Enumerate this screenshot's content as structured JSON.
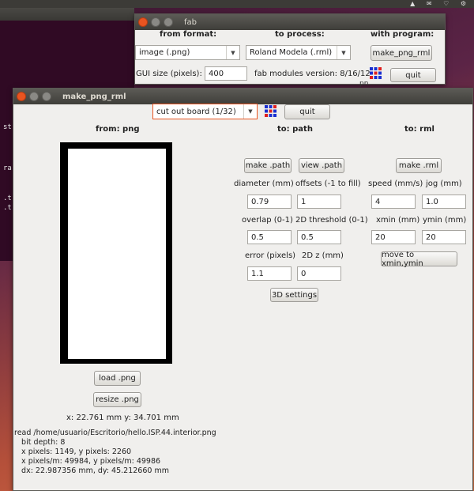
{
  "desktop": {
    "terminal_lines": [
      "st",
      "ra",
      ".tr",
      ".tr"
    ],
    "fab_window_extra": "pn"
  },
  "fab": {
    "title": "fab",
    "from_format_label": "from format:",
    "to_process_label": "to process:",
    "with_program_label": "with program:",
    "from_format_value": "image (.png)",
    "to_process_value": "Roland Modela (.rml)",
    "program_button": "make_png_rml",
    "gui_size_label": "GUI size (pixels):",
    "gui_size_value": "400",
    "version": "fab modules version: 8/16/12",
    "quit": "quit"
  },
  "make": {
    "title": "make_png_rml",
    "process_value": "cut out board (1/32)",
    "quit": "quit",
    "from_label": "from: png",
    "to_path_label": "to: path",
    "to_rml_label": "to: rml",
    "make_path": "make .path",
    "view_path": "view .path",
    "make_rml": "make .rml",
    "diameter_label": "diameter (mm)",
    "diameter_value": "0.79",
    "offsets_label": "offsets (-1 to fill)",
    "offsets_value": "1",
    "overlap_label": "overlap (0-1)",
    "overlap_value": "0.5",
    "threshold_label": "2D threshold (0-1)",
    "threshold_value": "0.5",
    "error_label": "error (pixels)",
    "error_value": "1.1",
    "z2d_label": "2D z (mm)",
    "z2d_value": "0",
    "settings3d": "3D settings",
    "speed_label": "speed (mm/s)",
    "speed_value": "4",
    "jog_label": "jog (mm)",
    "jog_value": "1.0",
    "xmin_label": "xmin (mm)",
    "xmin_value": "20",
    "ymin_label": "ymin (mm)",
    "ymin_value": "20",
    "move": "move to xmin,ymin",
    "load": "load .png",
    "resize": "resize .png",
    "coords": "x: 22.761 mm  y: 34.701 mm",
    "info": [
      "read /home/usuario/Escritorio/hello.ISP.44.interior.png",
      "   bit depth: 8",
      "   x pixels: 1149, y pixels: 2260",
      "   x pixels/m: 49984, y pixels/m: 49986",
      "   dx: 22.987356 mm, dy: 45.212660 mm"
    ]
  },
  "colors": {
    "accent": "#e95420",
    "logo_red": "#e02020",
    "logo_blue": "#1a2fd0"
  }
}
